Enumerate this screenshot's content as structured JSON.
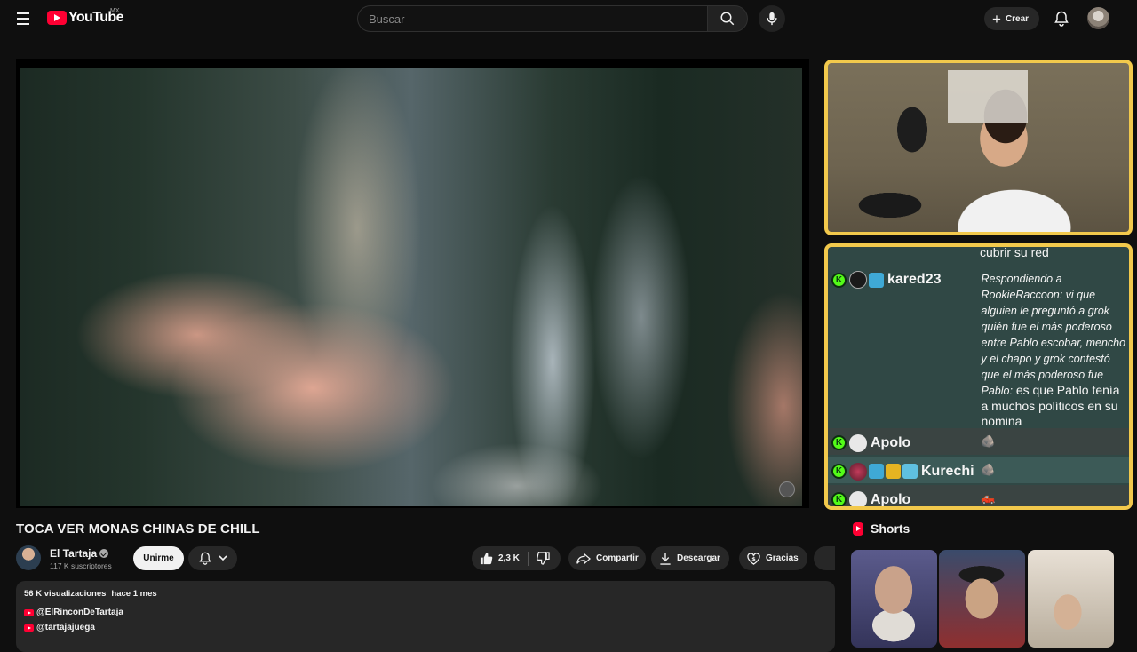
{
  "header": {
    "logo_text": "YouTube",
    "country_code": "MX",
    "search_placeholder": "Buscar",
    "create_label": "Crear"
  },
  "video": {
    "title": "TOCA VER MONAS CHINAS DE CHILL"
  },
  "channel": {
    "name": "El Tartaja",
    "subscribers": "117 K suscriptores",
    "join_label": "Unirme"
  },
  "actions": {
    "likes": "2,3 K",
    "share_label": "Compartir",
    "download_label": "Descargar",
    "thanks_label": "Gracias"
  },
  "description": {
    "views": "56 K visualizaciones",
    "date": "hace 1 mes",
    "links": [
      "@ElRinconDeTartaja",
      "@tartajajuega"
    ]
  },
  "chat": {
    "top_text": "cubrir su red",
    "messages": [
      {
        "user": "kared23",
        "reply_prefix": "Respondiendo a RookieRaccoon: vi que alguien le preguntó a grok quién fue el más poderoso entre Pablo escobar, mencho y el chapo y grok contestó que el más poderoso fue Pablo:",
        "text": "es que Pablo tenía a muchos políticos en su nomina"
      },
      {
        "user": "Apolo",
        "text": "🪨"
      },
      {
        "user": "Kurechi",
        "text": "🪨"
      },
      {
        "user": "Apolo",
        "text": "🛻"
      }
    ]
  },
  "shorts": {
    "heading": "Shorts"
  },
  "colors": {
    "accent": "#ff0033",
    "overlay_border": "#f2c94c",
    "chat_bg": "#304845",
    "kick_green": "#53fc18"
  }
}
